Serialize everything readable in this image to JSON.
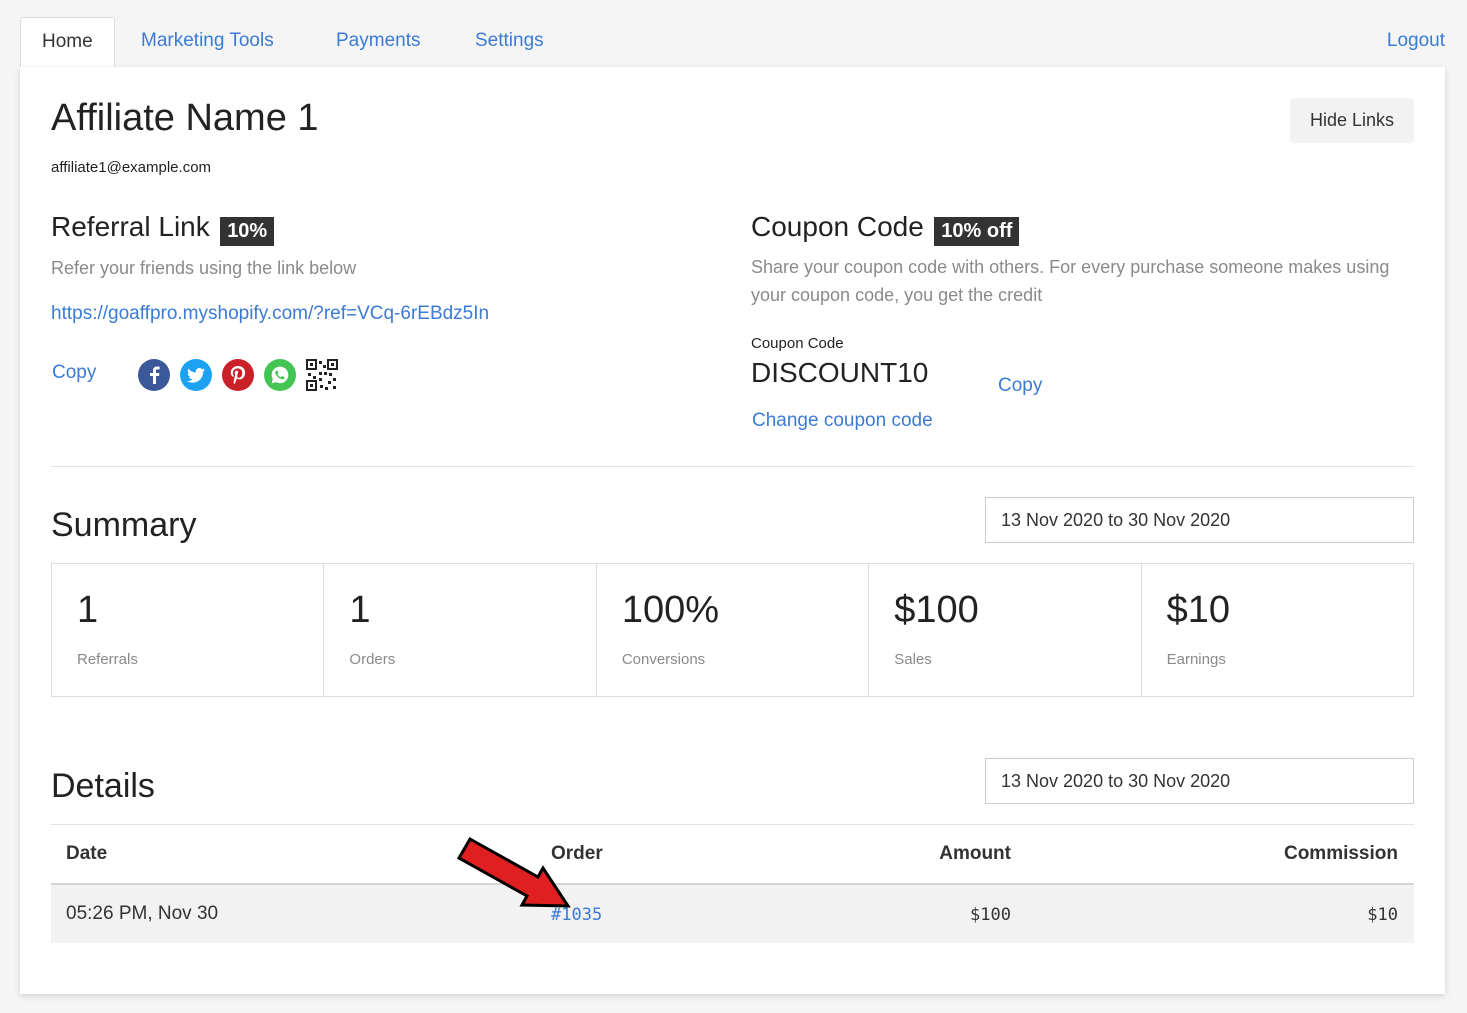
{
  "tabs": [
    {
      "label": "Home",
      "active": true
    },
    {
      "label": "Marketing Tools"
    },
    {
      "label": "Payments"
    },
    {
      "label": "Settings"
    }
  ],
  "logout_label": "Logout",
  "affiliate": {
    "name": "Affiliate Name 1",
    "email": "affiliate1@example.com"
  },
  "hide_links_label": "Hide Links",
  "referral": {
    "title": "Referral Link",
    "badge": "10%",
    "description": "Refer your friends using the link below",
    "url": "https://goaffpro.myshopify.com/?ref=VCq-6rEBdz5In",
    "copy_label": "Copy",
    "social_icons": [
      "facebook-icon",
      "twitter-icon",
      "pinterest-icon",
      "whatsapp-icon",
      "qr-code-icon"
    ]
  },
  "coupon": {
    "title": "Coupon Code",
    "badge": "10% off",
    "description": "Share your coupon code with others. For every purchase someone makes using your coupon code, you get the credit",
    "field_label": "Coupon Code",
    "code": "DISCOUNT10",
    "copy_label": "Copy",
    "change_label": "Change coupon code"
  },
  "summary": {
    "title": "Summary",
    "date_range": "13 Nov 2020 to 30 Nov 2020",
    "stats": [
      {
        "value": "1",
        "label": "Referrals"
      },
      {
        "value": "1",
        "label": "Orders"
      },
      {
        "value": "100%",
        "label": "Conversions"
      },
      {
        "value": "$100",
        "label": "Sales"
      },
      {
        "value": "$10",
        "label": "Earnings"
      }
    ]
  },
  "details": {
    "title": "Details",
    "date_range": "13 Nov 2020 to 30 Nov 2020",
    "columns": {
      "date": "Date",
      "order": "Order",
      "amount": "Amount",
      "commission": "Commission"
    },
    "rows": [
      {
        "date": "05:26 PM, Nov 30",
        "order": "#1035",
        "amount": "$100",
        "commission": "$10"
      }
    ]
  },
  "colors": {
    "link": "#3a7bd5",
    "badge_bg": "#333333",
    "annotation_arrow": "#e02020"
  }
}
